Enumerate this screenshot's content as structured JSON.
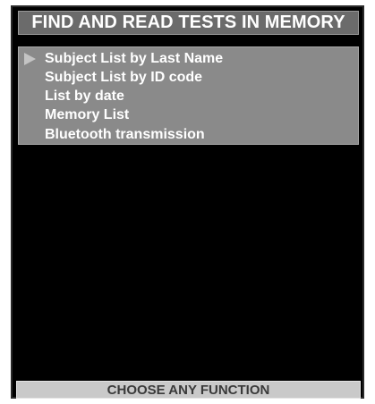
{
  "screen": {
    "title": "FIND AND READ TESTS IN MEMORY"
  },
  "menu": {
    "selected_index": 0,
    "items": [
      {
        "label": "Subject List by Last Name"
      },
      {
        "label": "Subject List by ID code"
      },
      {
        "label": "List by date"
      },
      {
        "label": "Memory List"
      },
      {
        "label": "Bluetooth transmission"
      }
    ]
  },
  "status": {
    "text": "CHOOSE ANY FUNCTION"
  },
  "icons": {
    "selection_pointer": "right-triangle-pointer-icon"
  },
  "colors": {
    "background": "#000000",
    "title_bar": "#6b6b6b",
    "menu_panel": "#8a8a8a",
    "status_bar": "#c9c9c9",
    "text_primary": "#ffffff",
    "status_text": "#3a3a3a"
  }
}
